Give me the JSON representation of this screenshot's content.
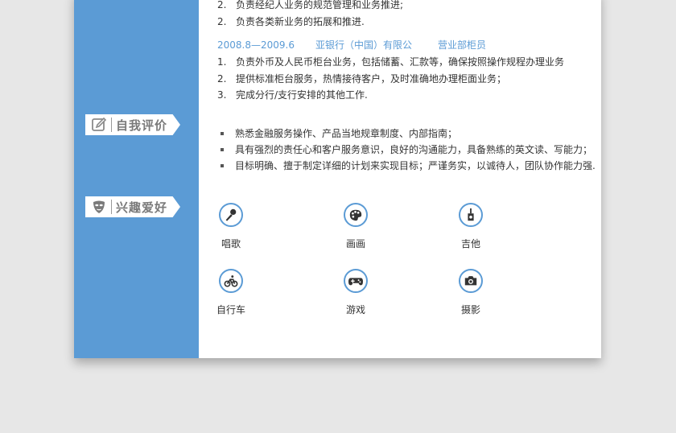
{
  "experience": {
    "prev_items": [
      {
        "num": "2.",
        "text": "负责经纪人业务的规范管理和业务推进;"
      },
      {
        "num": "2.",
        "text": "负责各类新业务的拓展和推进."
      }
    ],
    "job": {
      "period": "2008.8—2009.6",
      "company": "亚银行（中国）有限公",
      "position": "营业部柜员",
      "items": [
        {
          "num": "1.",
          "text": "负责外币及人民币柜台业务，包括储蓄、汇款等，确保按照操作规程办理业务"
        },
        {
          "num": "2.",
          "text": "提供标准柜台服务，热情接待客户，及时准确地办理柜面业务；"
        },
        {
          "num": "3.",
          "text": "完成分行/支行安排的其他工作."
        }
      ]
    }
  },
  "self_eval": {
    "title": "自我评价",
    "icon": "edit-icon",
    "items": [
      "熟悉金融服务操作、产品当地规章制度、内部指南；",
      "具有强烈的责任心和客户服务意识，良好的沟通能力，具备熟练的英文读、写能力；",
      "目标明确、擅于制定详细的计划来实现目标；严谨务实，以诚待人，团队协作能力强."
    ]
  },
  "hobbies": {
    "title": "兴趣爱好",
    "icon": "mask-icon",
    "items": [
      {
        "name": "唱歌",
        "icon": "microphone-icon"
      },
      {
        "name": "画画",
        "icon": "palette-icon"
      },
      {
        "name": "吉他",
        "icon": "guitar-icon"
      },
      {
        "name": "自行车",
        "icon": "bicycle-icon"
      },
      {
        "name": "游戏",
        "icon": "gamepad-icon"
      },
      {
        "name": "摄影",
        "icon": "camera-icon"
      }
    ]
  },
  "colors": {
    "accent": "#5b9bd5",
    "text": "#333333",
    "background": "#e7e7e7"
  }
}
